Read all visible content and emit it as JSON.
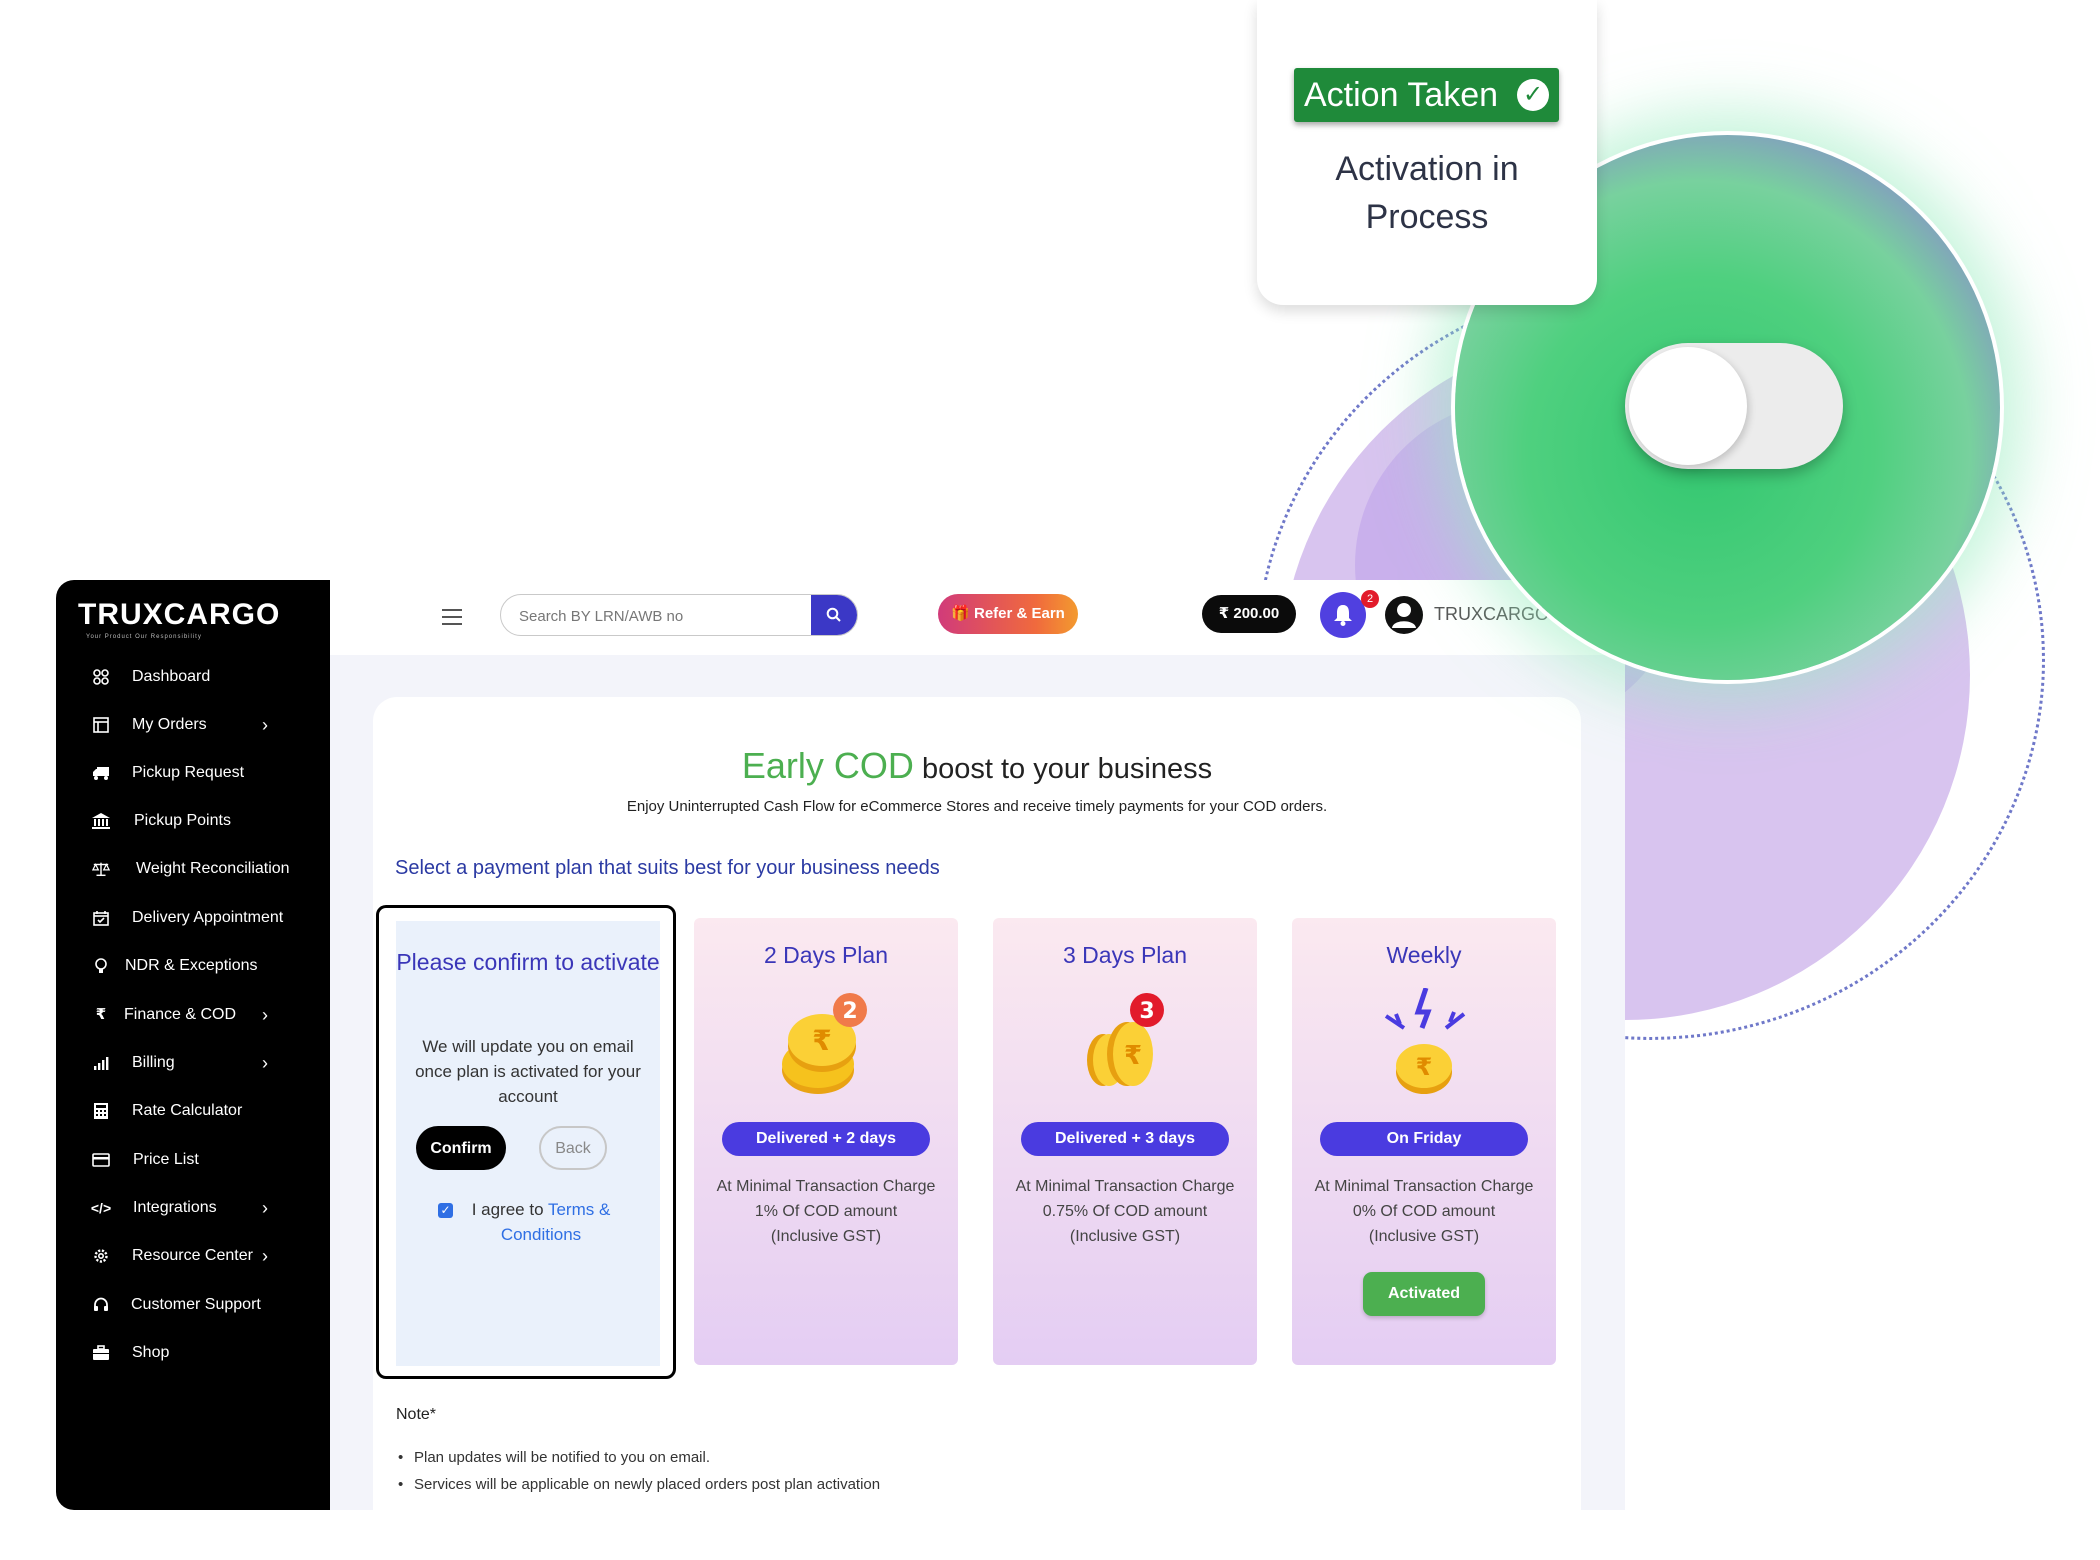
{
  "status_card": {
    "badge_label": "Action Taken",
    "status_line1": "Activation in",
    "status_line2": "Process"
  },
  "toggle": {
    "state": "off"
  },
  "sidebar": {
    "logo": "TRUXCARGO",
    "tagline": "Your Product Our Responsibility",
    "items": [
      {
        "label": "Dashboard",
        "icon": "dashboard-icon",
        "has_submenu": false
      },
      {
        "label": "My Orders",
        "icon": "orders-icon",
        "has_submenu": true
      },
      {
        "label": "Pickup Request",
        "icon": "truck-icon",
        "has_submenu": false
      },
      {
        "label": "Pickup Points",
        "icon": "bank-icon",
        "has_submenu": false
      },
      {
        "label": "Weight Reconciliation",
        "icon": "scale-icon",
        "has_submenu": false
      },
      {
        "label": "Delivery Appointment",
        "icon": "calendar-check-icon",
        "has_submenu": false
      },
      {
        "label": "NDR & Exceptions",
        "icon": "bulb-icon",
        "has_submenu": false
      },
      {
        "label": "Finance & COD",
        "icon": "rupee-icon",
        "has_submenu": true
      },
      {
        "label": "Billing",
        "icon": "bar-chart-icon",
        "has_submenu": true
      },
      {
        "label": "Rate Calculator",
        "icon": "calculator-icon",
        "has_submenu": false
      },
      {
        "label": "Price List",
        "icon": "credit-card-icon",
        "has_submenu": false
      },
      {
        "label": "Integrations",
        "icon": "code-icon",
        "has_submenu": true
      },
      {
        "label": "Resource Center",
        "icon": "gear-icon",
        "has_submenu": true
      },
      {
        "label": "Customer Support",
        "icon": "headset-icon",
        "has_submenu": false
      },
      {
        "label": "Shop",
        "icon": "briefcase-icon",
        "has_submenu": false
      }
    ]
  },
  "topbar": {
    "search_placeholder": "Search BY LRN/AWB no",
    "refer_label": "🎁 Refer & Earn",
    "wallet": "₹ 200.00",
    "notification_count": "2",
    "username": "TRUXCARGO"
  },
  "main": {
    "title_highlight": "Early COD",
    "title_rest": "boost to your business",
    "subtitle": "Enjoy Uninterrupted Cash Flow for eCommerce Stores and receive timely payments for your COD orders.",
    "select_prompt": "Select a payment plan that suits best for your business needs",
    "confirm": {
      "title": "Please confirm to activate",
      "body": "We will update you on email once plan is activated for your account",
      "confirm_label": "Confirm",
      "back_label": "Back",
      "agree_prefix": "I agree to",
      "agree_link": "Terms & Conditions",
      "agreed": true
    },
    "plans": [
      {
        "title": "2 Days Plan",
        "pill": "Delivered + 2 days",
        "desc1": "At Minimal Transaction Charge",
        "desc2": "1% Of COD amount",
        "desc3": "(Inclusive GST)",
        "badge": "2",
        "activated": ""
      },
      {
        "title": "3 Days Plan",
        "pill": "Delivered + 3 days",
        "desc1": "At Minimal Transaction Charge",
        "desc2": "0.75% Of COD amount",
        "desc3": "(Inclusive GST)",
        "badge": "3",
        "activated": ""
      },
      {
        "title": "Weekly",
        "pill": "On Friday",
        "desc1": "At Minimal Transaction Charge",
        "desc2": "0% Of COD amount",
        "desc3": "(Inclusive GST)",
        "badge": "",
        "activated": "Activated"
      }
    ],
    "note_title": "Note*",
    "notes": [
      "Plan updates will be notified to you on email.",
      "Services will be applicable on newly placed orders post plan activation"
    ]
  },
  "colors": {
    "accent": "#4a3be0",
    "green": "#4caf50",
    "action_green": "#1f8a3a",
    "sidebar_bg": "#000000",
    "link": "#2f6fe4"
  }
}
